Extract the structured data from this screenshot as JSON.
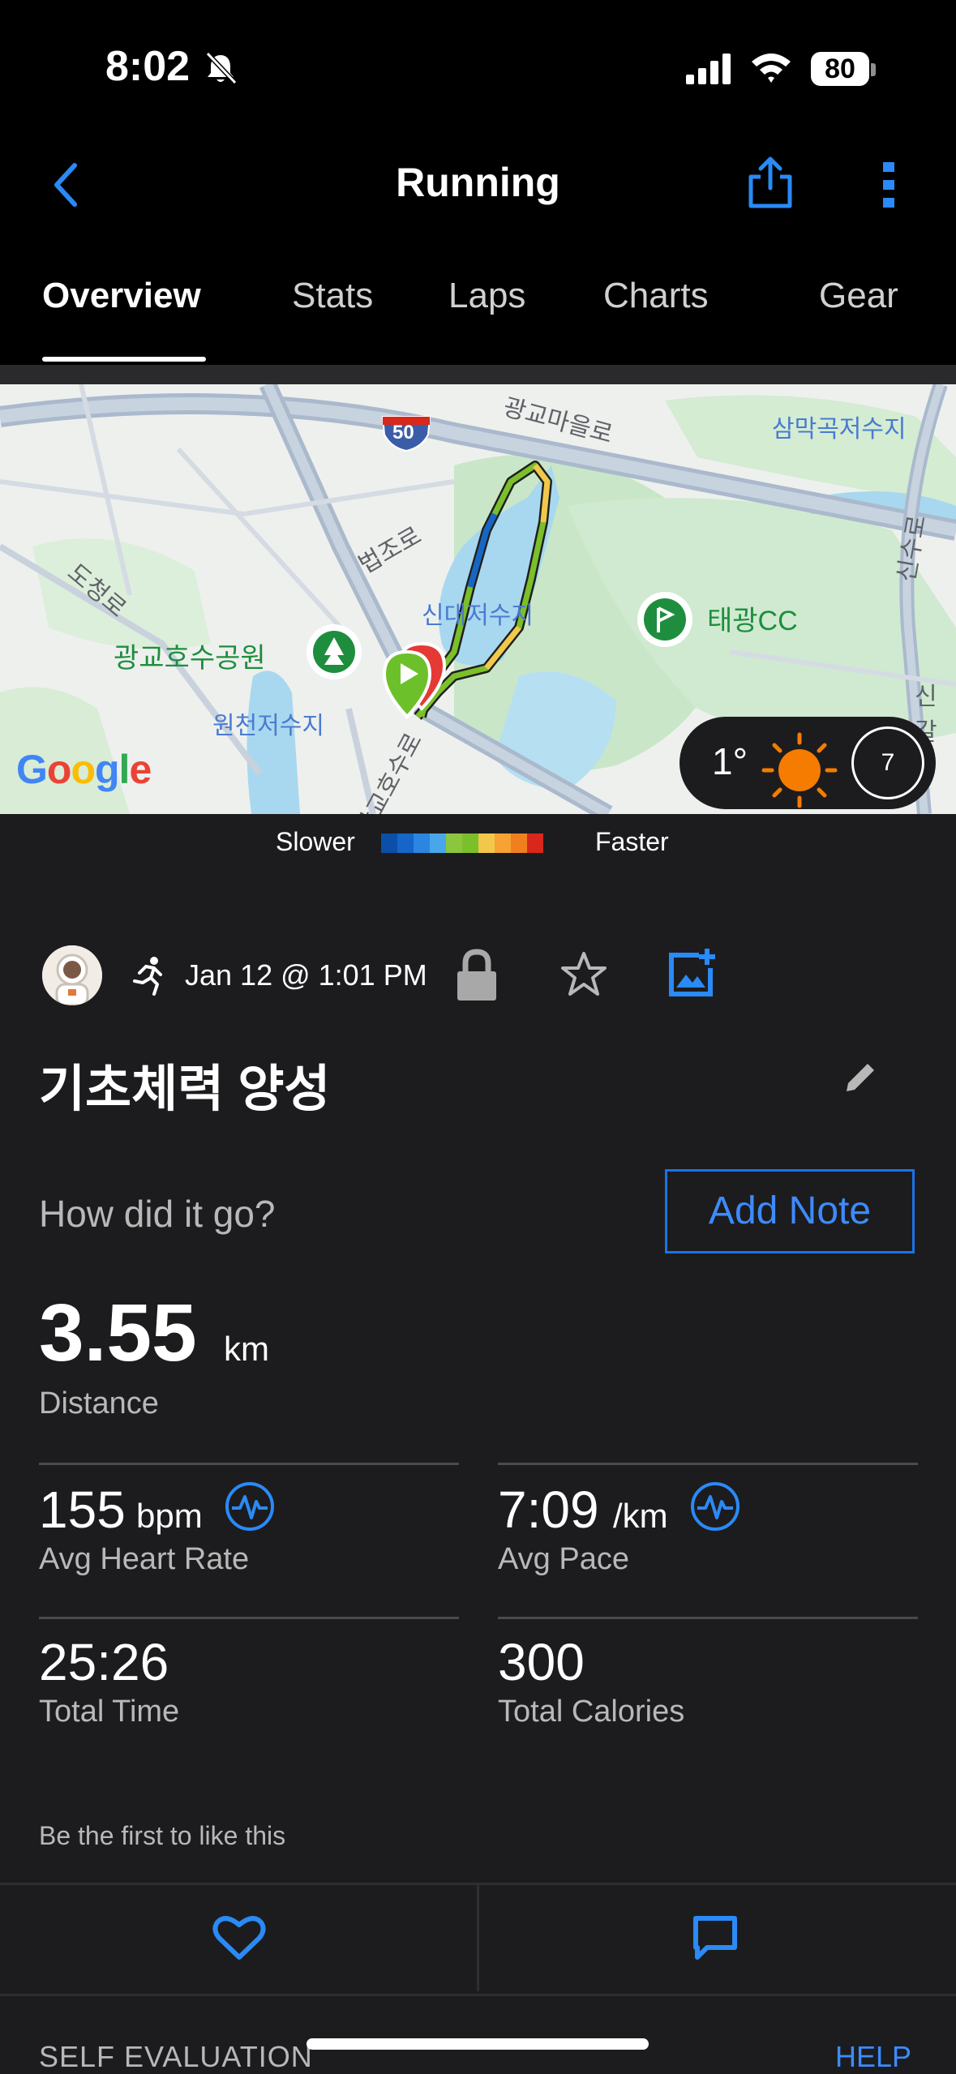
{
  "status_bar": {
    "time": "8:02",
    "battery": "80"
  },
  "nav": {
    "title": "Running"
  },
  "tabs": [
    {
      "label": "Overview",
      "active": true
    },
    {
      "label": "Stats"
    },
    {
      "label": "Laps"
    },
    {
      "label": "Charts"
    },
    {
      "label": "Gear"
    }
  ],
  "map": {
    "labels": {
      "road_50": "50",
      "village_road": "광교마을로",
      "reservoir_ne": "삼막곡저수지",
      "road_beopjo": "법조로",
      "road_docheong": "도청로",
      "reservoir_center": "신대저수지",
      "golf": "태광CC",
      "park": "광교호수공원",
      "reservoir_w": "원천저수지",
      "road_south": "광교호수로",
      "road_east": "신수로",
      "east_edge": "신갈"
    },
    "attribution": "Google",
    "weather": {
      "temperature": "1°",
      "wind": "7"
    }
  },
  "legend": {
    "slower": "Slower",
    "faster": "Faster",
    "colors": [
      "#0b4fa8",
      "#1566c8",
      "#2a86e0",
      "#4aa6ea",
      "#8cc63f",
      "#7bbf2a",
      "#f2c84b",
      "#f7a233",
      "#f07f1d",
      "#d9271c"
    ]
  },
  "activity": {
    "date": "Jan 12 @ 1:01 PM",
    "name": "기초체력 양성",
    "note_prompt": "How did it go?",
    "add_note": "Add Note"
  },
  "stats": {
    "distance": {
      "value": "3.55",
      "unit": "km",
      "label": "Distance"
    },
    "heart_rate": {
      "value": "155",
      "unit": "bpm",
      "label": "Avg Heart Rate"
    },
    "pace": {
      "value": "7:09",
      "unit": "/km",
      "label": "Avg Pace"
    },
    "time": {
      "value": "25:26",
      "label": "Total Time"
    },
    "calories": {
      "value": "300",
      "label": "Total Calories"
    }
  },
  "social": {
    "likes_text": "Be the first to like this"
  },
  "footer": {
    "section": "SELF EVALUATION",
    "help": "HELP"
  }
}
